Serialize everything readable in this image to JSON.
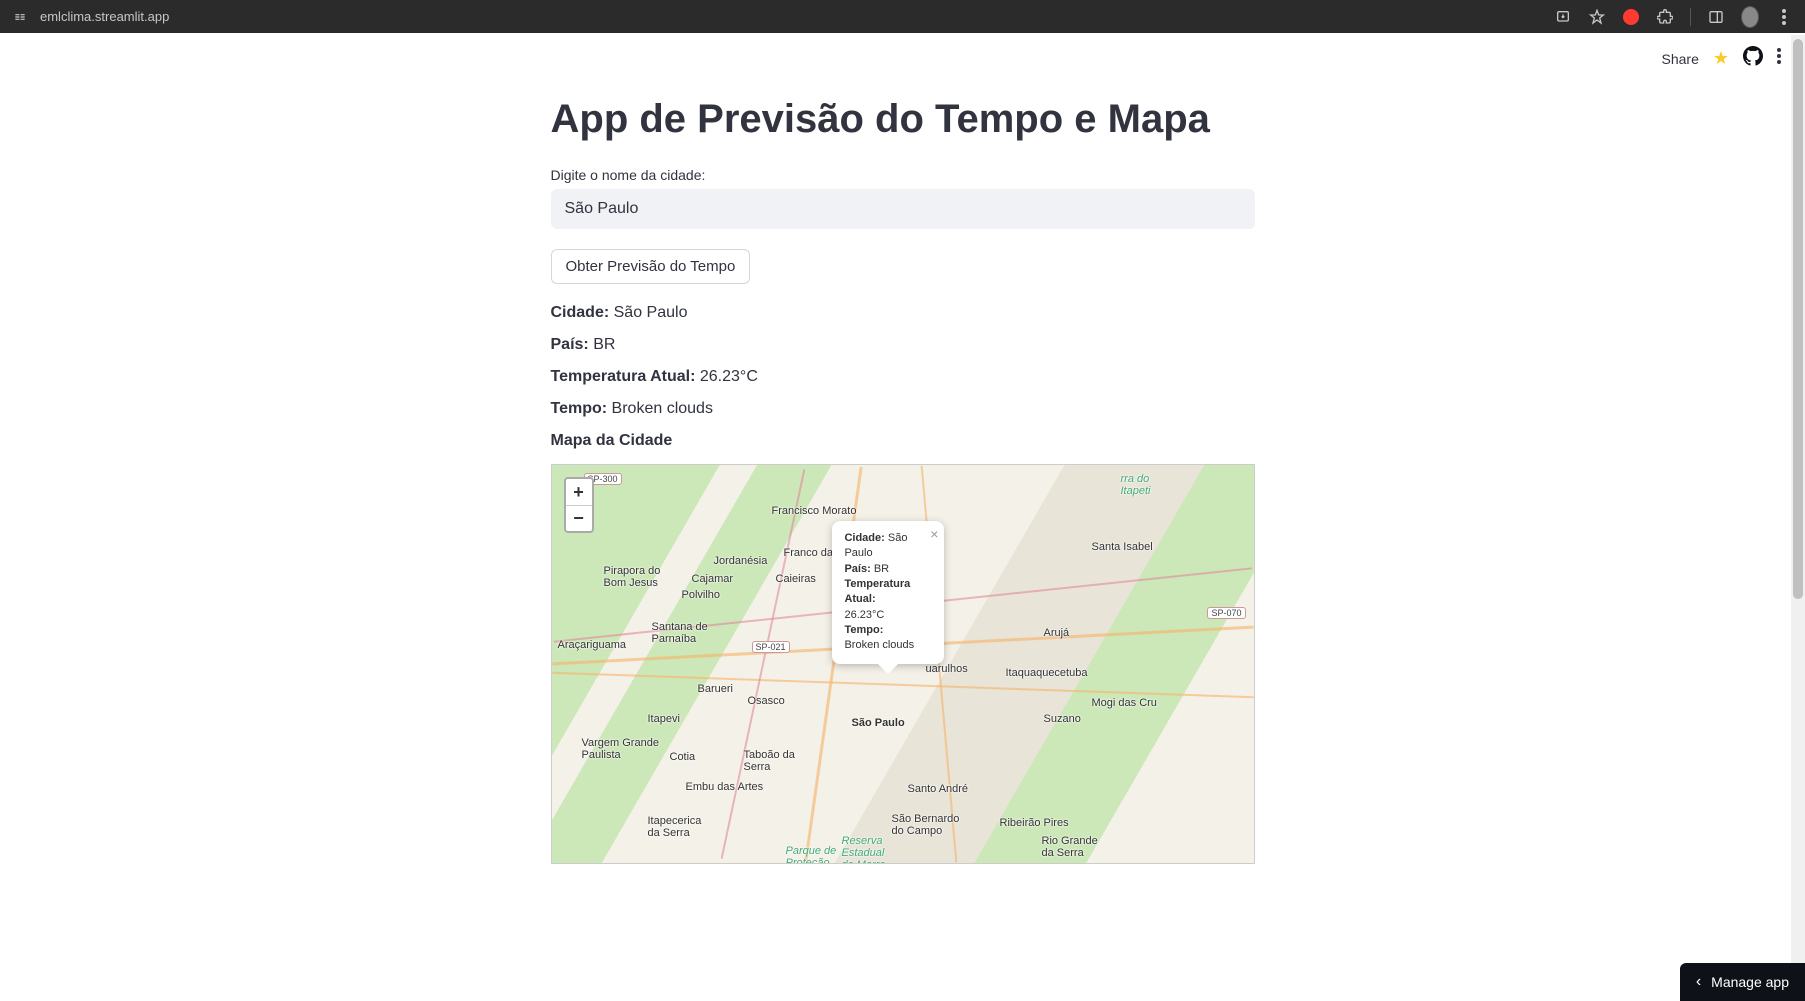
{
  "browser": {
    "url": "emlclima.streamlit.app"
  },
  "toolbar": {
    "share": "Share"
  },
  "page": {
    "title": "App de Previsão do Tempo e Mapa",
    "input_label": "Digite o nome da cidade:",
    "input_value": "São Paulo",
    "button_label": "Obter Previsão do Tempo",
    "info": {
      "cidade_label": "Cidade:",
      "cidade_value": "São Paulo",
      "pais_label": "País:",
      "pais_value": "BR",
      "temp_label": "Temperatura Atual:",
      "temp_value": "26.23°C",
      "tempo_label": "Tempo:",
      "tempo_value": "Broken clouds"
    },
    "map_label": "Mapa da Cidade"
  },
  "map": {
    "zoom_in": "+",
    "zoom_out": "−",
    "badges": {
      "sp300": "SP-300",
      "sp021": "SP-021",
      "sp070": "SP-070"
    },
    "cities": {
      "francisco_morato": "Francisco Morato",
      "franco_da": "Franco da",
      "jordanesia": "Jordanésia",
      "cajamar": "Cajamar",
      "caieiras": "Caieiras",
      "polvilho": "Polvilho",
      "pirapora_bom_jesus": "Pirapora do\nBom Jesus",
      "aracariguama": "Araçariguama",
      "santana_parnaiba": "Santana de\nParnaíba",
      "barueri": "Barueri",
      "osasco": "Osasco",
      "itapevi": "Itapevi",
      "vargem_grande": "Vargem Grande\nPaulista",
      "cotia": "Cotia",
      "taboao_serra": "Taboão da\nSerra",
      "embu_artes": "Embu das Artes",
      "itapecerica": "Itapecerica\nda Serra",
      "sao_paulo": "São Paulo",
      "santo_andre": "Santo André",
      "sao_bernardo": "São Bernardo\ndo Campo",
      "ribeirao_pires": "Ribeirão Pires",
      "rio_grande": "Rio Grande\nda Serra",
      "guarulhos": "uarulhos",
      "aruja": "Arujá",
      "santa_isabel": "Santa Isabel",
      "itaquaquecetuba": "Itaquaquecetuba",
      "suzano": "Suzano",
      "mogi": "Mogi das Cru",
      "itapeti": "rra do\nItapeti",
      "reserva": "Reserva\nEstadual\ndo Morro",
      "parque_ambiental": "Parque de\nProteção\nAmbiental"
    },
    "popup": {
      "cidade_label": "Cidade:",
      "cidade_value": "São Paulo",
      "pais_label": "País:",
      "pais_value": "BR",
      "temp_label": "Temperatura Atual:",
      "temp_value": "26.23°C",
      "tempo_label": "Tempo:",
      "tempo_value": "Broken clouds"
    }
  },
  "footer": {
    "manage_app": "Manage app"
  }
}
